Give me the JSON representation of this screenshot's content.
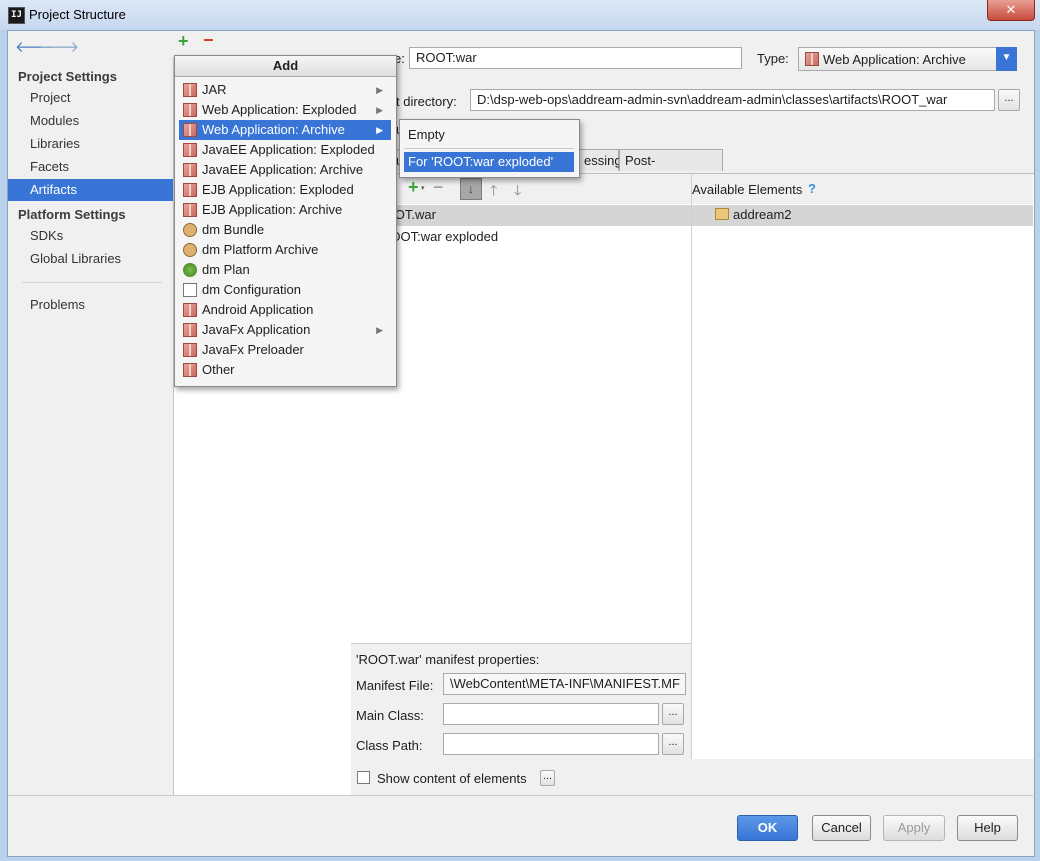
{
  "window": {
    "title": "Project Structure",
    "close": "✕"
  },
  "nav": {
    "project_settings_header": "Project Settings",
    "items_project": [
      "Project",
      "Modules",
      "Libraries",
      "Facets",
      "Artifacts"
    ],
    "platform_settings_header": "Platform Settings",
    "items_platform": [
      "SDKs",
      "Global Libraries"
    ],
    "problems": "Problems",
    "selected": "Artifacts"
  },
  "artifact": {
    "name_label_fragment": "e:",
    "name_value": "ROOT:war",
    "type_label": "Type:",
    "type_value": "Web Application: Archive",
    "output_label_fragment": "t directory:",
    "output_value": "D:\\dsp-web-ops\\addream-admin-svn\\addream-admin\\classes\\artifacts\\ROOT_war",
    "browse": "...",
    "include_fragment": "u",
    "tabs": [
      "u",
      "essing",
      "Post-processing"
    ]
  },
  "tree": {
    "rows": [
      ".OOT.war",
      "ROOT:war exploded"
    ],
    "root_frag": "'ROOT.war",
    "available_header": "Available Elements",
    "help": "?",
    "available_items": [
      "addream2"
    ]
  },
  "manifest": {
    "title": "'ROOT.war' manifest properties:",
    "file_label": "Manifest File:",
    "file_value": "\\WebContent\\META-INF\\MANIFEST.MF",
    "main_class_label": "Main Class:",
    "class_path_label": "Class Path:",
    "show_content": "Show content of elements"
  },
  "buttons": {
    "ok": "OK",
    "cancel": "Cancel",
    "apply": "Apply",
    "help": "Help"
  },
  "add_menu": {
    "header": "Add",
    "items": [
      {
        "label": "JAR",
        "icon": "archive-icon",
        "submenu": true
      },
      {
        "label": "Web Application: Exploded",
        "icon": "archive-icon",
        "submenu": true
      },
      {
        "label": "Web Application: Archive",
        "icon": "archive-icon",
        "submenu": true,
        "selected": true
      },
      {
        "label": "JavaEE Application: Exploded",
        "icon": "archive-icon",
        "submenu": false
      },
      {
        "label": "JavaEE Application: Archive",
        "icon": "archive-icon",
        "submenu": false
      },
      {
        "label": "EJB Application: Exploded",
        "icon": "archive-icon",
        "submenu": false
      },
      {
        "label": "EJB Application: Archive",
        "icon": "archive-icon",
        "submenu": false
      },
      {
        "label": "dm Bundle",
        "icon": "bundle-icon",
        "submenu": false
      },
      {
        "label": "dm Platform Archive",
        "icon": "bundle-icon",
        "submenu": false
      },
      {
        "label": "dm Plan",
        "icon": "plan-icon",
        "submenu": false
      },
      {
        "label": "dm Configuration",
        "icon": "document-icon",
        "submenu": false
      },
      {
        "label": "Android Application",
        "icon": "archive-icon",
        "submenu": false
      },
      {
        "label": "JavaFx Application",
        "icon": "archive-icon",
        "submenu": true
      },
      {
        "label": "JavaFx Preloader",
        "icon": "archive-icon",
        "submenu": false
      },
      {
        "label": "Other",
        "icon": "archive-icon",
        "submenu": false
      }
    ]
  },
  "sub_menu": {
    "items": [
      "Empty",
      "For 'ROOT:war exploded'"
    ],
    "selected": "For 'ROOT:war exploded'"
  },
  "colors": {
    "selection": "#3875d7",
    "ok_button": "#3875d7"
  }
}
